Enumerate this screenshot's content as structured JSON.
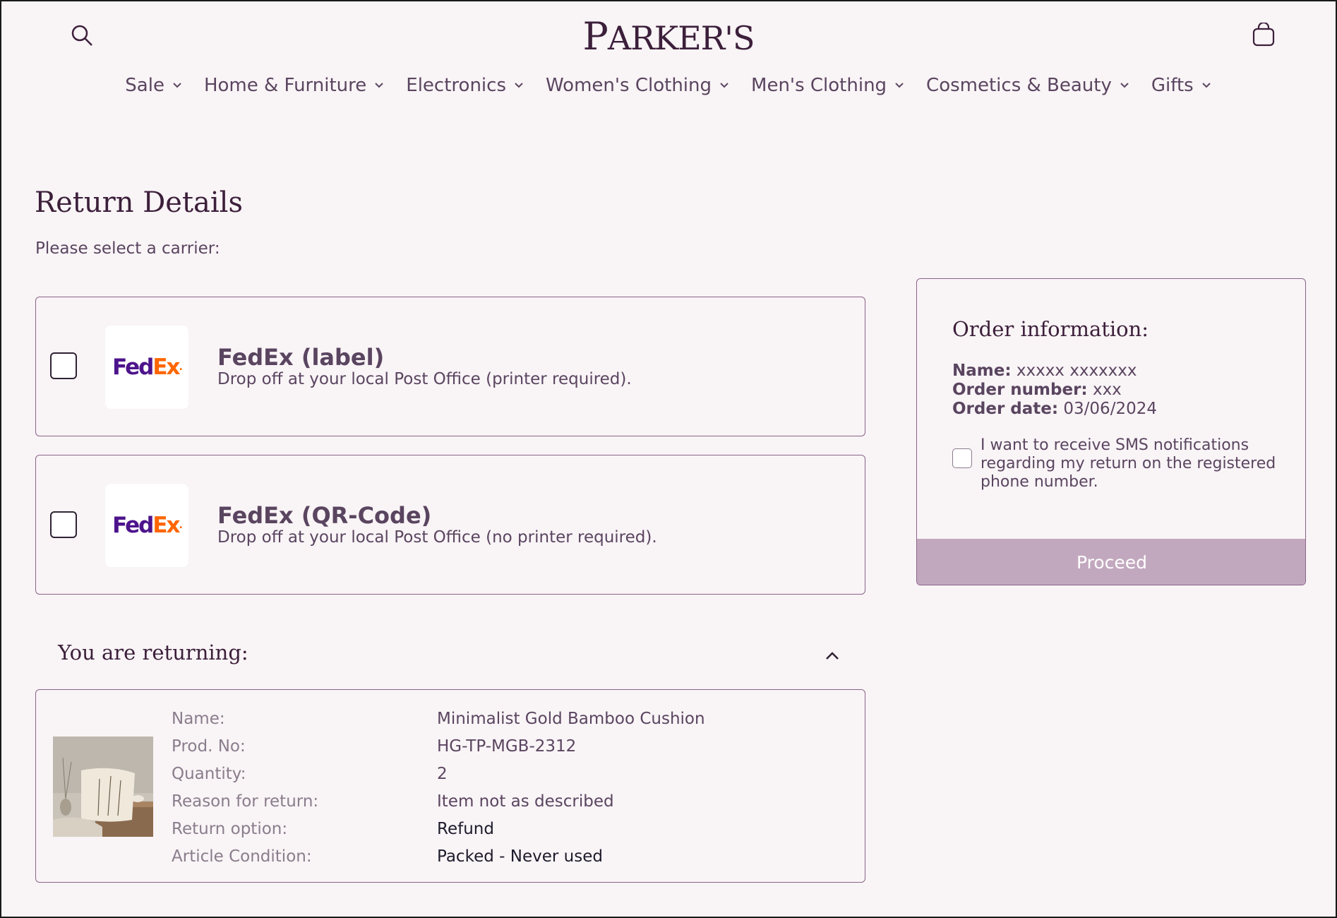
{
  "header": {
    "logo_first": "P",
    "logo_rest": "ARKER",
    "logo_apos": "'S",
    "nav": [
      {
        "label": "Sale"
      },
      {
        "label": "Home & Furniture"
      },
      {
        "label": "Electronics"
      },
      {
        "label": "Women's Clothing"
      },
      {
        "label": "Men's Clothing"
      },
      {
        "label": "Cosmetics & Beauty"
      },
      {
        "label": "Gifts"
      }
    ]
  },
  "main": {
    "title": "Return Details",
    "subtitle": "Please select a carrier:",
    "carriers": [
      {
        "logo_a": "Fed",
        "logo_b": "Ex",
        "logo_dot": ".",
        "name": "FedEx (label)",
        "description": "Drop off at your local Post Office (printer required)."
      },
      {
        "logo_a": "Fed",
        "logo_b": "Ex",
        "logo_dot": ".",
        "name": "FedEx (QR-Code)",
        "description": "Drop off at your local Post Office (no printer required)."
      }
    ],
    "returning_title": "You are returning:",
    "item": {
      "labels": [
        "Name:",
        "Prod. No:",
        "Quantity:",
        "Reason for return:",
        "Return option:",
        "Article Condition:"
      ],
      "values": [
        "Minimalist Gold Bamboo Cushion",
        "HG-TP-MGB-2312",
        "2",
        "Item not as described",
        "Refund",
        "Packed - Never used"
      ]
    }
  },
  "order": {
    "title": "Order information:",
    "name_label": "Name:",
    "name_value": "xxxxx xxxxxxx",
    "number_label": "Order number:",
    "number_value": "xxx",
    "date_label": "Order date:",
    "date_value": "03/06/2024",
    "sms_text": "I want to receive SMS notifications regarding my return on the registered phone number.",
    "proceed_label": "Proceed"
  }
}
